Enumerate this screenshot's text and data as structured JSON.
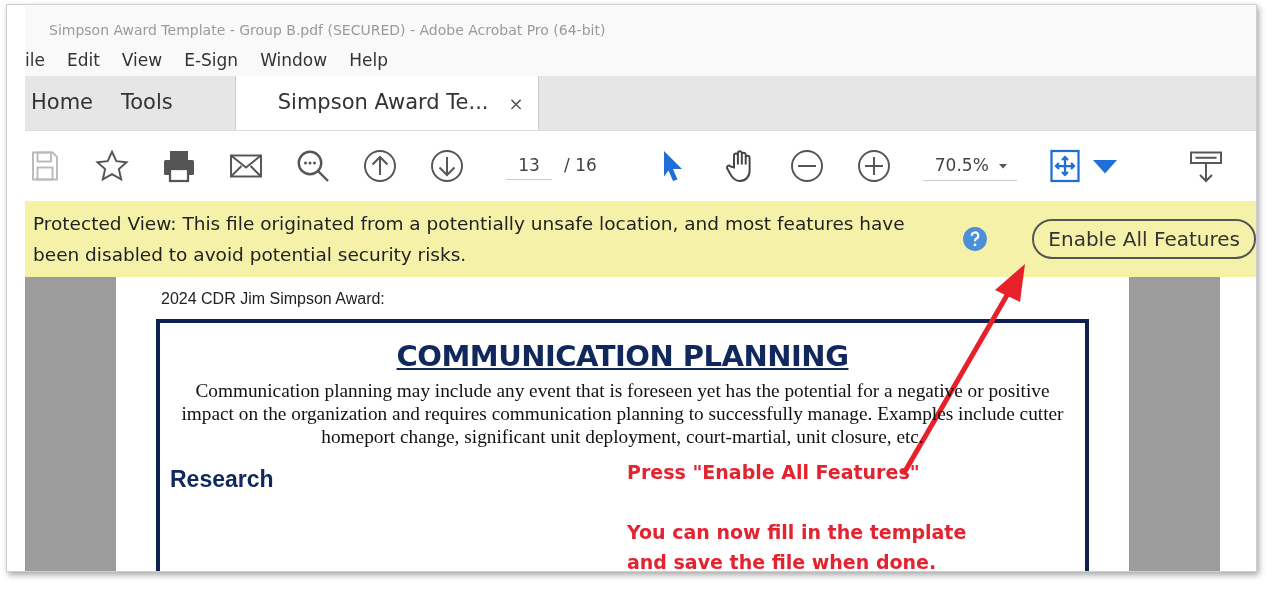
{
  "window": {
    "title": "Simpson Award Template - Group B.pdf (SECURED) - Adobe Acrobat Pro (64-bit)"
  },
  "menu": [
    "ile",
    "Edit",
    "View",
    "E-Sign",
    "Window",
    "Help"
  ],
  "tabs": [
    {
      "label": "Home",
      "selected": false
    },
    {
      "label": "Tools",
      "selected": false
    },
    {
      "label": "Simpson Award Te...",
      "selected": true,
      "close": "×"
    }
  ],
  "toolbar": {
    "page_number": "13",
    "page_total": "/ 16",
    "zoom": "70.5%"
  },
  "protected_view": {
    "message": "Protected View: This file originated from a potentially unsafe location, and most features have been disabled to avoid potential security risks.",
    "button": "Enable All Features"
  },
  "document": {
    "header": "2024 CDR Jim Simpson Award:",
    "title": "COMMUNICATION PLANNING",
    "intro": "Communication planning may include any event that is foreseen yet has the potential for a negative or positive impact on the organization and requires communication planning to successfully manage. Examples include cutter homeport change, significant unit deployment, court-martial, unit closure, etc.",
    "section_heading": "Research"
  },
  "annotation": {
    "lines": [
      "Press \"Enable All Features\"",
      "You can now fill in the template",
      "and save the file when done."
    ]
  }
}
